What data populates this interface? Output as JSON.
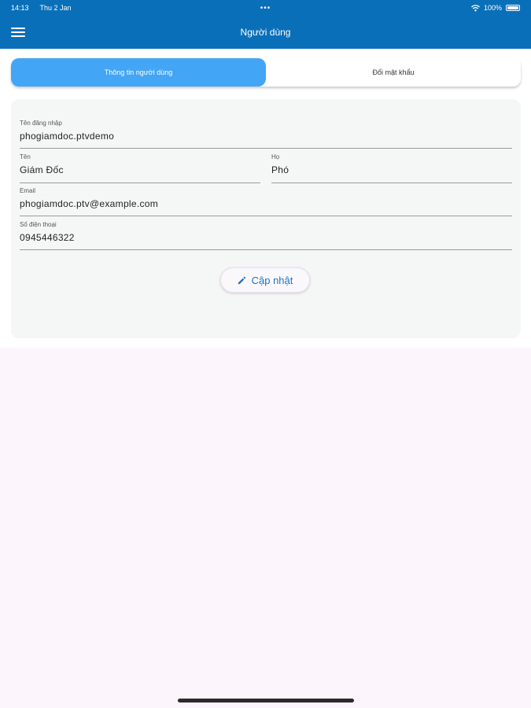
{
  "status_bar": {
    "time": "14:13",
    "date": "Thu 2 Jan",
    "dots": "•••",
    "battery": "100%"
  },
  "app_bar": {
    "title": "Người dùng",
    "menu_icon": "hamburger-menu-icon"
  },
  "tabs": [
    {
      "label": "Thông tin người dùng",
      "active": true
    },
    {
      "label": "Đổi mật khẩu",
      "active": false
    }
  ],
  "form": {
    "username": {
      "label": "Tên đăng nhập",
      "value": "phogiamdoc.ptvdemo"
    },
    "first_name": {
      "label": "Tên",
      "value": "Giám Đốc"
    },
    "last_name": {
      "label": "Họ",
      "value": "Phó"
    },
    "email": {
      "label": "Email",
      "value": "phogiamdoc.ptv@example.com"
    },
    "phone": {
      "label": "Số điện thoại",
      "value": "0945446322"
    }
  },
  "update_button": {
    "label": "Cập nhật",
    "icon": "pencil-icon"
  },
  "colors": {
    "primary": "#0a6fb9",
    "tab_active": "#42a5f5",
    "button_text": "#1a73c8",
    "background": "#fcf5fb"
  }
}
